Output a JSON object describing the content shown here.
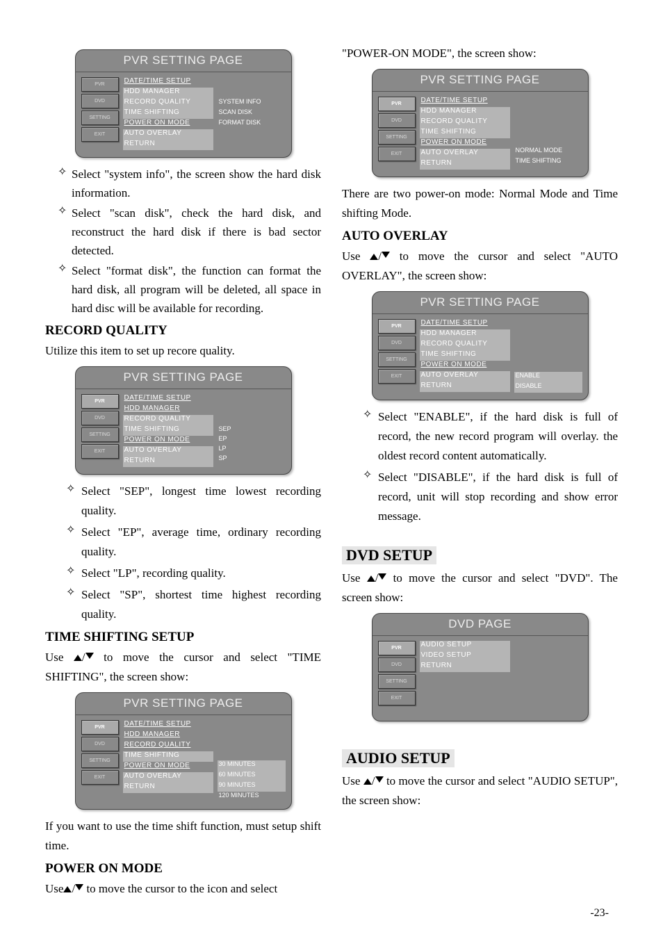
{
  "pageNum": "-23-",
  "diamond": "✧",
  "nav": {
    "pvr": "PVR",
    "dvd": "DVD",
    "setting": "SETTING",
    "exit": "EXIT"
  },
  "pvrItems": {
    "date": "DATE/TIME SETUP",
    "hdd": "HDD MANAGER",
    "rq": "RECORD QUALITY",
    "ts": "TIME SHIFTING",
    "pom": "POWER ON MODE",
    "ao": "AUTO OVERLAY",
    "ret": "RETURN"
  },
  "col1": {
    "m1": {
      "title": "PVR SETTING PAGE",
      "sub": [
        "SYSTEM INFO",
        "SCAN DISK",
        "FORMAT DISK"
      ]
    },
    "b1": "Select \"system info\", the screen show the hard disk information.",
    "b2": "Select \"scan disk\", check the hard disk, and reconstruct the hard disk if there is bad sector detected.",
    "b3": "Select \"format disk\", the function can format the hard disk, all program will be deleted, all space in hard disc will be available for recording.",
    "rq_h": "RECORD QUALITY",
    "rq_t": "Utilize this item to set up recore quality.",
    "m2": {
      "title": "PVR SETTING PAGE",
      "sub": [
        "SEP",
        "EP",
        "LP",
        "SP"
      ]
    },
    "b4": "Select \"SEP\", longest time lowest recording quality.",
    "b5": "Select \"EP\", average time, ordinary recording quality.",
    "b6": "Select \"LP\", recording quality.",
    "b7": "Select \"SP\", shortest time highest recording quality.",
    "ts_h": "TIME SHIFTING SETUP",
    "ts_t1": "Use ",
    "ts_t2": "/",
    "ts_t3": " to move the cursor and select \"TIME SHIFTING\", the screen show:",
    "m3": {
      "title": "PVR SETTING PAGE",
      "sub": [
        "30   MINUTES",
        "60   MINUTES",
        "90   MINUTES",
        "120 MINUTES"
      ]
    },
    "sh_t": "If you want to use the time shift function, must setup shift time.",
    "pom_h": "POWER ON MODE",
    "pom_t1": "Use",
    "pom_t2": "/",
    "pom_t3": " to move the cursor to the icon and select"
  },
  "col2": {
    "top": "\"POWER-ON MODE\", the screen show:",
    "m4": {
      "title": "PVR SETTING PAGE",
      "sub": [
        "NORMAL MODE",
        "TIME SHIFTING"
      ]
    },
    "t2": "There are two power-on mode: Normal Mode and Time shifting Mode.",
    "ao_h": "AUTO OVERLAY",
    "ao_t1": "Use ",
    "ao_t2": "/",
    "ao_t3": " to move the cursor and select \"AUTO OVERLAY\", the screen show:",
    "m5": {
      "title": "PVR SETTING PAGE",
      "sub": [
        "ENABLE",
        "DISABLE"
      ]
    },
    "b8": "Select \"ENABLE\", if the hard disk is full of record, the new record program will overlay. the oldest record content automatically.",
    "b9": "Select \"DISABLE\", if the hard disk is full of record, unit will stop recording and show error message.",
    "dvd_h": "DVD SETUP",
    "dvd_t1": "Use ",
    "dvd_t2": "/",
    "dvd_t3": " to move the cursor and select \"DVD\". The screen show:",
    "m6": {
      "title": "DVD PAGE",
      "items": [
        "AUDIO SETUP",
        "VIDEO SETUP",
        "RETURN"
      ]
    },
    "au_h": "AUDIO SETUP",
    "au_t1": "Use ",
    "au_t2": "/",
    "au_t3": " to move the cursor and select \"AUDIO SETUP\", the screen show:"
  }
}
